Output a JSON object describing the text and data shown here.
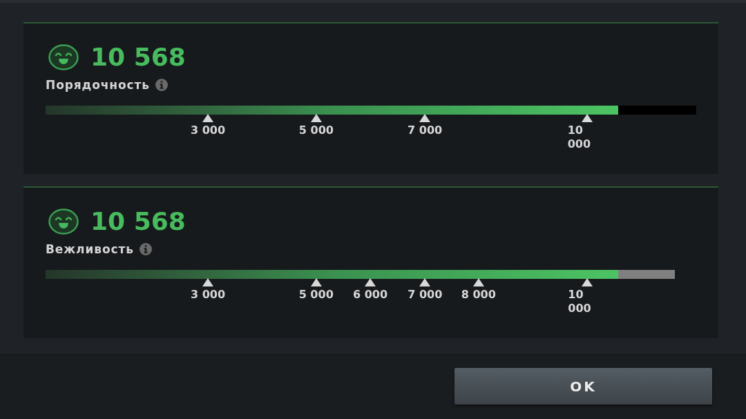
{
  "meters": [
    {
      "score": "10 568",
      "label": "Порядочность",
      "level": 0.88,
      "track": {
        "color": "#000000"
      },
      "markers": [
        {
          "label": "3 000",
          "level": 0.2495
        },
        {
          "label": "5 000",
          "level": 0.416
        },
        {
          "label": "7 000",
          "level": 0.583
        },
        {
          "label": "10 000",
          "level": 0.832
        }
      ]
    },
    {
      "score": "10 568",
      "label": "Вежливость",
      "level": 0.91,
      "track": {
        "color": "#808080"
      },
      "markers": [
        {
          "label": "3 000",
          "level": 0.258
        },
        {
          "label": "5 000",
          "level": 0.43
        },
        {
          "label": "6 000",
          "level": 0.516
        },
        {
          "label": "7 000",
          "level": 0.603
        },
        {
          "label": "8 000",
          "level": 0.688
        },
        {
          "label": "10 000",
          "level": 0.861
        }
      ]
    }
  ],
  "buttons": [
    {
      "label": "OK"
    }
  ]
}
